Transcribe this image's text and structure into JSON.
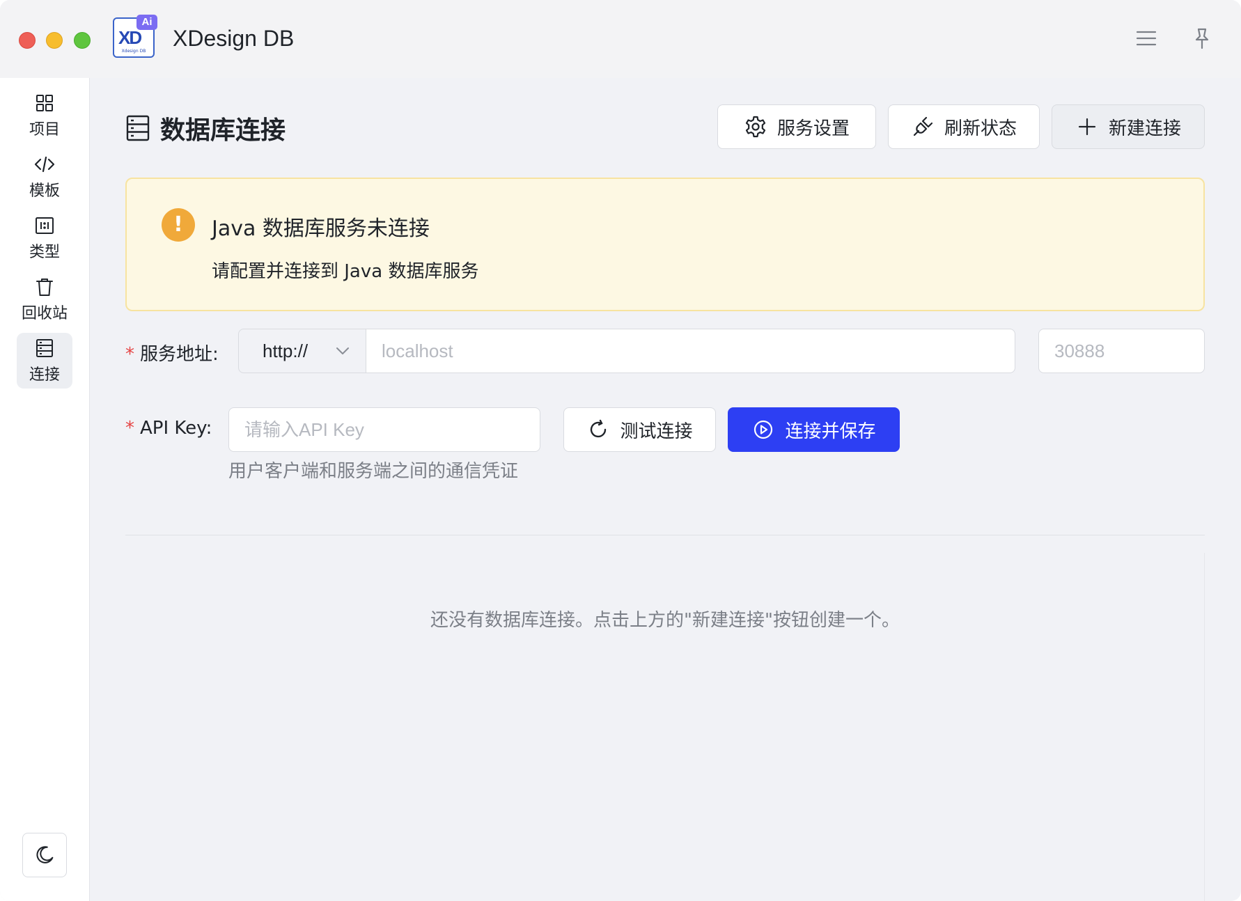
{
  "app": {
    "title": "XDesign DB",
    "logo_text": "XD",
    "logo_badge": "Ai",
    "logo_sub": "Xdesign DB"
  },
  "titlebar": {
    "menu_icon": "hamburger-menu-icon",
    "pin_icon": "pin-icon"
  },
  "sidebar": {
    "items": [
      {
        "label": "项目",
        "icon": "grid-icon",
        "active": false
      },
      {
        "label": "模板",
        "icon": "code-icon",
        "active": false
      },
      {
        "label": "类型",
        "icon": "type-icon",
        "active": false
      },
      {
        "label": "回收站",
        "icon": "trash-icon",
        "active": false
      },
      {
        "label": "连接",
        "icon": "database-icon",
        "active": true
      }
    ],
    "theme_icon": "moon-icon"
  },
  "header": {
    "title": "数据库连接",
    "buttons": {
      "settings": "服务设置",
      "refresh": "刷新状态",
      "new": "新建连接"
    }
  },
  "alert": {
    "title": "Java 数据库服务未连接",
    "message": "请配置并连接到 Java 数据库服务",
    "icon_text": "!"
  },
  "form": {
    "required_mark": "*",
    "service_label": "服务地址:",
    "protocol": "http://",
    "host_placeholder": "localhost",
    "port_placeholder": "30888",
    "api_key_label": "API Key:",
    "api_key_placeholder": "请输入API Key",
    "api_key_hint": "用户客户端和服务端之间的通信凭证",
    "test_button": "测试连接",
    "connect_button": "连接并保存"
  },
  "empty_state": "还没有数据库连接。点击上方的\"新建连接\"按钮创建一个。",
  "colors": {
    "primary": "#2d3ff3",
    "warning": "#f0a93a",
    "alert_bg": "#fdf8e3",
    "required": "#e54545"
  }
}
